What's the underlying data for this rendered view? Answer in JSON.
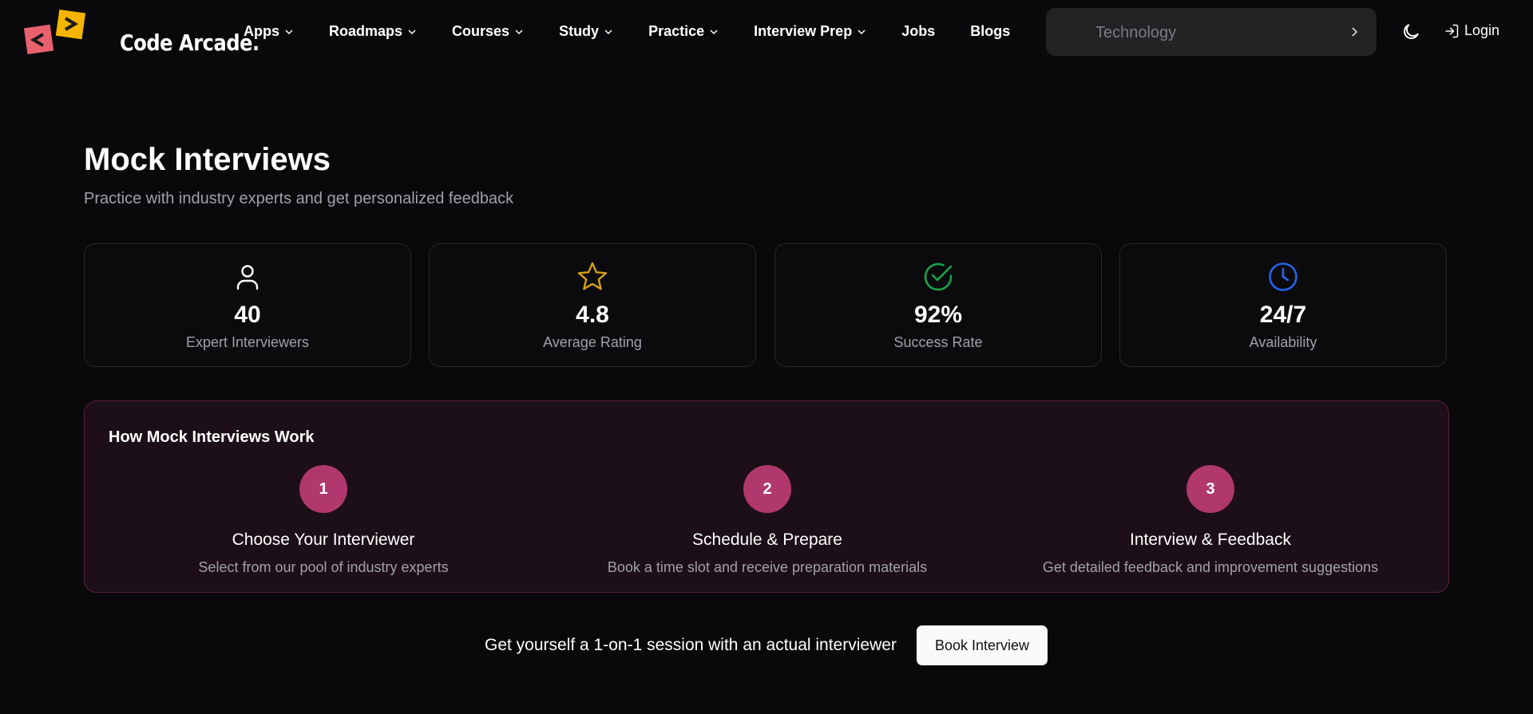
{
  "brand": {
    "name": "Code Arcade."
  },
  "nav": {
    "items": [
      {
        "label": "Apps",
        "dropdown": true
      },
      {
        "label": "Roadmaps",
        "dropdown": true
      },
      {
        "label": "Courses",
        "dropdown": true
      },
      {
        "label": "Study",
        "dropdown": true
      },
      {
        "label": "Practice",
        "dropdown": true
      },
      {
        "label": "Interview Prep",
        "dropdown": true
      },
      {
        "label": "Jobs",
        "dropdown": false
      },
      {
        "label": "Blogs",
        "dropdown": false
      }
    ],
    "search_placeholder": "Technology",
    "login_label": "Login"
  },
  "hero": {
    "title": "Mock Interviews",
    "subtitle": "Practice with industry experts and get personalized feedback"
  },
  "stats": [
    {
      "icon": "user-icon",
      "value": "40",
      "label": "Expert Interviewers",
      "color": "#ffffff"
    },
    {
      "icon": "star-icon",
      "value": "4.8",
      "label": "Average Rating",
      "color": "#d4a017"
    },
    {
      "icon": "check-circle-icon",
      "value": "92%",
      "label": "Success Rate",
      "color": "#16a34a"
    },
    {
      "icon": "clock-icon",
      "value": "24/7",
      "label": "Availability",
      "color": "#2563eb"
    }
  ],
  "how": {
    "title": "How Mock Interviews Work",
    "steps": [
      {
        "num": "1",
        "title": "Choose Your Interviewer",
        "desc": "Select from our pool of industry experts"
      },
      {
        "num": "2",
        "title": "Schedule & Prepare",
        "desc": "Book a time slot and receive preparation materials"
      },
      {
        "num": "3",
        "title": "Interview & Feedback",
        "desc": "Get detailed feedback and improvement suggestions"
      }
    ]
  },
  "cta": {
    "text": "Get yourself a 1-on-1 session with an actual interviewer",
    "button": "Book Interview"
  },
  "colors": {
    "accent": "#b0386d",
    "background": "#09090b",
    "logo_red": "#e8616c",
    "logo_yellow": "#f5b400"
  }
}
